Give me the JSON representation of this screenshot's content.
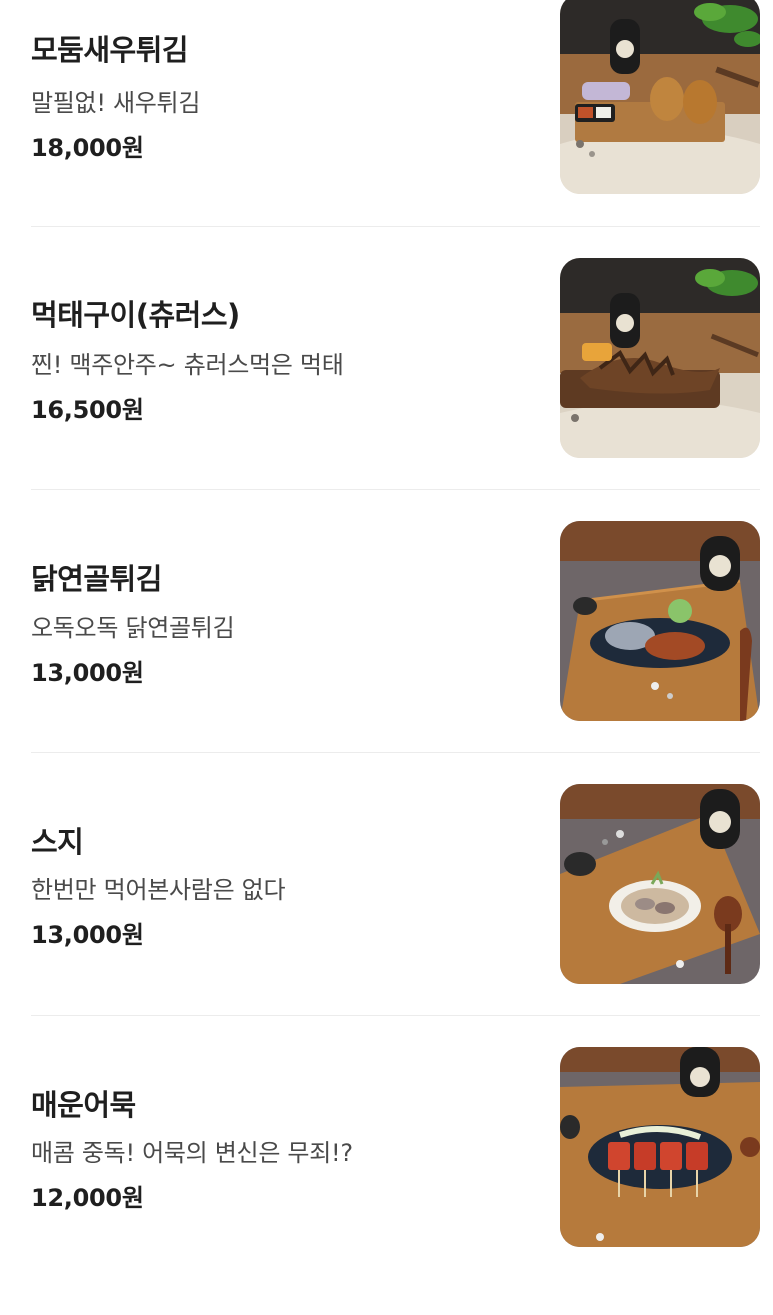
{
  "menu": {
    "items": [
      {
        "name": "모둠새우튀김",
        "description": "말필없! 새우튀김",
        "price": "18,000원",
        "photo": "fried-shrimp-platter-photo"
      },
      {
        "name": "먹태구이(츄러스)",
        "description": "찐! 맥주안주~ 츄러스먹은 먹태",
        "price": "16,500원",
        "photo": "grilled-dried-pollack-photo"
      },
      {
        "name": "닭연골튀김",
        "description": "오독오독 닭연골튀김",
        "price": "13,000원",
        "photo": "fried-chicken-cartilage-photo"
      },
      {
        "name": "스지",
        "description": "한번만 먹어본사람은 없다",
        "price": "13,000원",
        "photo": "beef-tendon-bowl-photo"
      },
      {
        "name": "매운어묵",
        "description": "매콤 중독! 어묵의 변신은 무죄!?",
        "price": "12,000원",
        "photo": "spicy-fishcake-skewers-photo"
      }
    ]
  }
}
